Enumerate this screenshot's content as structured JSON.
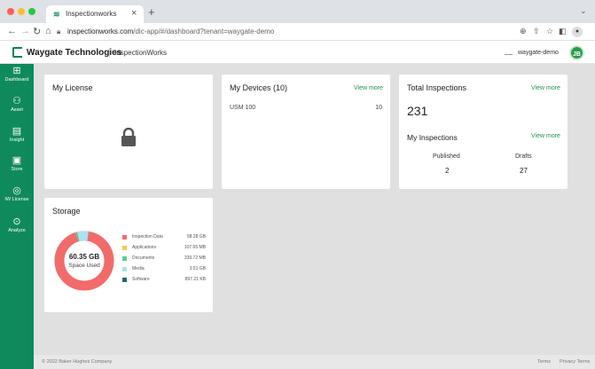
{
  "browser": {
    "tab_title": "Inspectionworks",
    "url_host": "inspectionworks.com",
    "url_path": "/dic-app/#/dashboard?tenant=waygate-demo"
  },
  "header": {
    "brand": "Waygate Technologies",
    "product": "InspectionWorks",
    "tenant": "waygate-demo",
    "user_initials": "JB"
  },
  "sidebar": {
    "items": [
      {
        "label": "Dashboard",
        "icon": "dashboard-icon"
      },
      {
        "label": "Asset",
        "icon": "asset-icon"
      },
      {
        "label": "Insight",
        "icon": "insight-icon"
      },
      {
        "label": "Store",
        "icon": "store-icon"
      },
      {
        "label": "IW License",
        "icon": "license-icon"
      },
      {
        "label": "Analyze",
        "icon": "analyze-icon"
      }
    ]
  },
  "license": {
    "title": "My License"
  },
  "devices": {
    "title": "My Devices (10)",
    "view_more": "View more",
    "rows": [
      {
        "name": "USM 100",
        "count": "10"
      }
    ]
  },
  "inspections": {
    "title": "Total Inspections",
    "view_more": "View more",
    "total": "231",
    "my_title": "My Inspections",
    "my_view_more": "View more",
    "published_label": "Published",
    "published_value": "2",
    "drafts_label": "Drafts",
    "drafts_value": "27"
  },
  "storage": {
    "title": "Storage",
    "used_value": "60.35 GB",
    "used_label": "Space Used",
    "legend": [
      {
        "name": "Inspection Data",
        "size": "58.28 GB",
        "color": "#f26b6b"
      },
      {
        "name": "Applications",
        "size": "107.65 MB",
        "color": "#f7c94b"
      },
      {
        "name": "Documents",
        "size": "339.72 MB",
        "color": "#5ccf8e"
      },
      {
        "name": "Media",
        "size": "3.51 GB",
        "color": "#a9e2f0"
      },
      {
        "name": "Software",
        "size": "897.21 KB",
        "color": "#1b6b6e"
      }
    ]
  },
  "footer": {
    "copyright": "© 2022 Baker Hughes Company",
    "terms": "Terms",
    "privacy": "Privacy Terms"
  },
  "colors": {
    "accent": "#0f8a5c",
    "link": "#1a9650"
  }
}
